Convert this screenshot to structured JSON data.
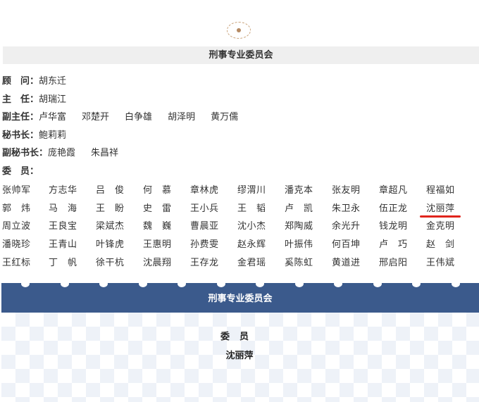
{
  "section_title": "刑事专业委员会",
  "roles": [
    {
      "label": "顾　问：",
      "names": [
        "胡东迁"
      ]
    },
    {
      "label": "主　任：",
      "names": [
        "胡瑞江"
      ]
    },
    {
      "label": "副主任：",
      "names": [
        "卢华富",
        "邓楚开",
        "白争雄",
        "胡泽明",
        "黄万儒"
      ]
    },
    {
      "label": "秘书长：",
      "names": [
        "鲍莉莉"
      ]
    },
    {
      "label": "副秘书长：",
      "names": [
        "庞艳霞",
        "朱昌祥"
      ]
    },
    {
      "label": "委　员：",
      "names": []
    }
  ],
  "members": [
    [
      "张帅军",
      "方志华",
      "吕俊",
      "何慕",
      "章林虎",
      "缪渭川",
      "潘克本",
      "张友明",
      "章超凡",
      "程福如"
    ],
    [
      "郭炜",
      "马海",
      "王盼",
      "史雷",
      "王小兵",
      "王韬",
      "卢凯",
      "朱卫永",
      "伍正龙",
      "沈丽萍"
    ],
    [
      "周立波",
      "王良宝",
      "梁斌杰",
      "魏巍",
      "曹晨亚",
      "沈小杰",
      "郑陶威",
      "余光升",
      "钱龙明",
      "金克明"
    ],
    [
      "潘晓珍",
      "王青山",
      "叶锋虎",
      "王惠明",
      "孙费雯",
      "赵永辉",
      "叶振伟",
      "何百坤",
      "卢巧",
      "赵剑"
    ],
    [
      "王红标",
      "丁帆",
      "徐干杭",
      "沈晨翔",
      "王存龙",
      "金君瑶",
      "奚陈虹",
      "黄道进",
      "邢启阳",
      "王伟斌"
    ]
  ],
  "card": {
    "banner_title": "刑事专业委员会",
    "role": "委员",
    "name": "沈丽萍"
  },
  "colors": {
    "banner_bg": "#3b5a8c",
    "highlight_underline": "#e0241c",
    "title_bar_bg": "#efefef"
  }
}
